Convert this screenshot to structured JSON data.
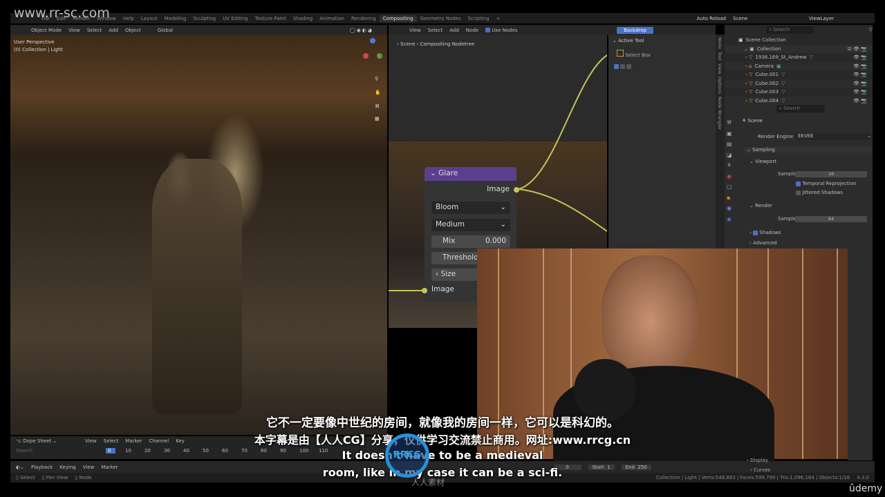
{
  "watermark": "www.rr-sc.com",
  "menu": [
    "File",
    "Edit",
    "Render",
    "Window",
    "Help"
  ],
  "workspaces": [
    "Layout",
    "Modeling",
    "Sculpting",
    "UV Editing",
    "Texture Paint",
    "Shading",
    "Animation",
    "Rendering",
    "Compositing",
    "Geometry Nodes",
    "Scripting"
  ],
  "top_right": {
    "auto_reload": "Auto Reload",
    "scene": "Scene",
    "view_layer": "ViewLayer"
  },
  "viewport": {
    "mode": "Object Mode",
    "menu": [
      "View",
      "Select",
      "Add",
      "Object"
    ],
    "transform": "Global",
    "overlay_title": "User Perspective",
    "overlay_sub": "(0) Collection | Light"
  },
  "node_editor": {
    "menu": [
      "View",
      "Select",
      "Add",
      "Node"
    ],
    "use_nodes": "Use Nodes",
    "backdrop": "Backdrop",
    "breadcrumb": [
      "Scene",
      "Compositing Nodetree"
    ],
    "node": {
      "title": "Glare",
      "output": "Image",
      "type": "Bloom",
      "quality": "Medium",
      "mix_label": "Mix",
      "mix_value": "0.000",
      "threshold": "Threshold",
      "size": "Size",
      "input": "Image"
    }
  },
  "n_panel": {
    "header": "Active Tool",
    "tool": "Select Box",
    "tabs": [
      "Node",
      "Tool",
      "View",
      "Options",
      "Node Wrangler"
    ]
  },
  "outliner": {
    "search": "Search",
    "root": "Scene Collection",
    "collection": "Collection",
    "items": [
      "1938.169_St_Andrew",
      "Camera",
      "Cube.001",
      "Cube.002",
      "Cube.003",
      "Cube.004"
    ]
  },
  "properties": {
    "search": "Search",
    "scene": "Scene",
    "render_engine_label": "Render Engine",
    "render_engine": "EEVEE",
    "sampling": "Sampling",
    "viewport": "Viewport",
    "samples_label": "Samples",
    "viewport_samples": "16",
    "temporal": "Temporal Reprojection",
    "jittered": "Jittered Shadows",
    "render": "Render",
    "render_samples": "64",
    "shadows": "Shadows",
    "advanced": "Advanced",
    "display": "Display",
    "curves": "Curves"
  },
  "dopesheet": {
    "mode": "Dope Sheet",
    "menu": [
      "View",
      "Select",
      "Marker",
      "Channel",
      "Key"
    ],
    "search": "Search",
    "frames": [
      "0",
      "10",
      "20",
      "30",
      "40",
      "50",
      "60",
      "70",
      "80",
      "90",
      "100",
      "110"
    ]
  },
  "timeline": {
    "menu": [
      "Playback",
      "Keying",
      "View",
      "Marker"
    ],
    "current": "0",
    "start_label": "Start",
    "start": "1",
    "end_label": "End",
    "end": "250"
  },
  "statusbar": {
    "hints": [
      "Select",
      "Pan View",
      "Node"
    ],
    "stats": "Collection | Light | Verts:548,883 | Faces:599,799 | Tris:1,096,184 | Objects:1/16",
    "version": "4.3.0"
  },
  "subtitles": [
    "它不一定要像中世纪的房间，就像我的房间一样，它可以是科幻的。",
    "本字幕是由【人人CG】分享，仅供学习交流禁止商用。网址:www.rrcg.cn",
    "It doesn't have to be a medieval",
    "room, like in my case it can be a sci-fi."
  ],
  "logos": {
    "rrcg": "RRCG",
    "rrcg_sub": "人人素材",
    "udemy": "ûdemy"
  },
  "colors": {
    "accent": "#4a72c4",
    "node_header": "#5b3f8f",
    "socket": "#c9c45a",
    "active_tab": "#303030"
  }
}
